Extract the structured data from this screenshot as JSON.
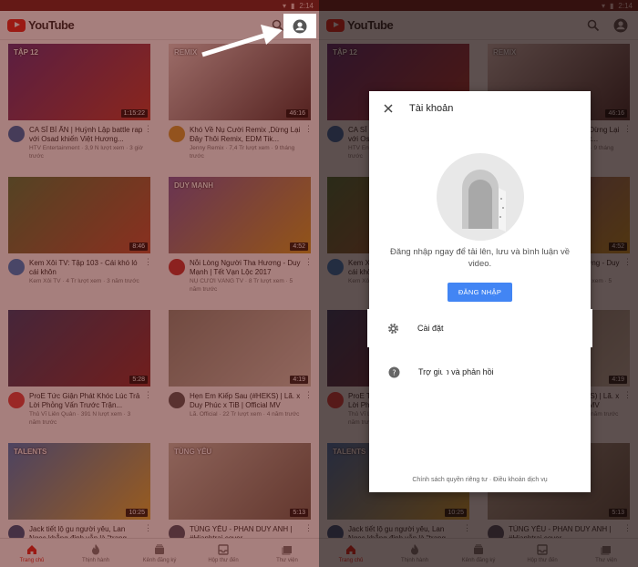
{
  "status_bar": {
    "time": "2:14"
  },
  "app_bar": {
    "logo_text": "YouTube"
  },
  "videos": [
    {
      "title": "CA SĨ BÍ ẨN | Huỳnh Lập battle rap với Osad khiến Việt Hương...",
      "meta": "HTV Entertainment · 3,9 N lượt xem · 3 giờ trước",
      "duration": "1:15:22",
      "thumb": [
        "#5a2a7a",
        "#c0392b"
      ],
      "avatar": "#2b6cb0",
      "badge": "TẬP 12"
    },
    {
      "title": "Khó Về Nụ Cười Remix ,Dừng Lại Đây Thôi Remix, EDM Tik...",
      "meta": "Jenny Remix · 7,4 Tr lượt xem · 9 tháng trước",
      "duration": "46:16",
      "thumb": [
        "#e8d5d0",
        "#4a3030"
      ],
      "avatar": "#d69e2e",
      "badge": "REMIX"
    },
    {
      "title": "Kem Xôi TV: Tập 103 - Cái khó ló cái khôn",
      "meta": "Kem Xôi TV · 4 Tr lượt xem · 3 năm trước",
      "duration": "8:46",
      "thumb": [
        "#4a7a3a",
        "#c05030"
      ],
      "avatar": "#3182ce",
      "badge": ""
    },
    {
      "title": "Nỗi Lòng Người Tha Hương - Duy Mạnh | Tết Vạn Lộc 2017",
      "meta": "NỤ CƯỜI VÀNG TV · 8 Tr lượt xem · 5 năm trước",
      "duration": "4:52",
      "thumb": [
        "#7a5aa0",
        "#d4a020"
      ],
      "avatar": "#c53030",
      "badge": "DUY MẠNH"
    },
    {
      "title": "ProE Tức Giận Phát Khóc Lúc Trả Lời Phỏng Vấn Trước Trận...",
      "meta": "Thủ Vĩ Liên Quân · 391 N lượt xem · 3 năm trước",
      "duration": "5:28",
      "thumb": [
        "#2a3a6a",
        "#8a2a2a"
      ],
      "avatar": "#e53e3e",
      "badge": ""
    },
    {
      "title": "Hẹn Em Kiếp Sau (#HEKS) | Lã. x Duy Phúc x TiB | Official MV",
      "meta": "Lã. Official · 22 Tr lượt xem · 4 năm trước",
      "duration": "4:19",
      "thumb": [
        "#8a8a7a",
        "#d0c8b8"
      ],
      "avatar": "#555555",
      "badge": ""
    },
    {
      "title": "Jack tiết lộ gu người yêu, Lan Ngọc khẳng định vẫn là \"trang...",
      "meta": "",
      "duration": "10:25",
      "thumb": [
        "#3a7ac0",
        "#e0b030"
      ],
      "avatar": "#2c5282",
      "badge": "TALENTS"
    },
    {
      "title": "TÙNG YÊU - PHAN DUY ANH | #Hianhtrai cover",
      "meta": "",
      "duration": "5:13",
      "thumb": [
        "#c8c0b0",
        "#6a6050"
      ],
      "avatar": "#4a5568",
      "badge": "TÙNG YÊU"
    }
  ],
  "bottom_nav": [
    {
      "label": "Trang chủ",
      "icon": "home-icon"
    },
    {
      "label": "Thịnh hành",
      "icon": "flame-icon"
    },
    {
      "label": "Kênh đăng ký",
      "icon": "subscriptions-icon"
    },
    {
      "label": "Hộp thư đến",
      "icon": "inbox-icon"
    },
    {
      "label": "Thư viện",
      "icon": "library-icon"
    }
  ],
  "dialog": {
    "title": "Tài khoản",
    "message": "Đăng nhập ngay để tải lên, lưu và bình luận về video.",
    "sign_in": "ĐĂNG NHẬP",
    "settings": "Cài đặt",
    "help": "Trợ giúp và phản hồi",
    "footer": "Chính sách quyền riêng tư · Điều khoản dịch vụ"
  },
  "colors": {
    "brand": "#e62117",
    "signin": "#4285f4"
  }
}
